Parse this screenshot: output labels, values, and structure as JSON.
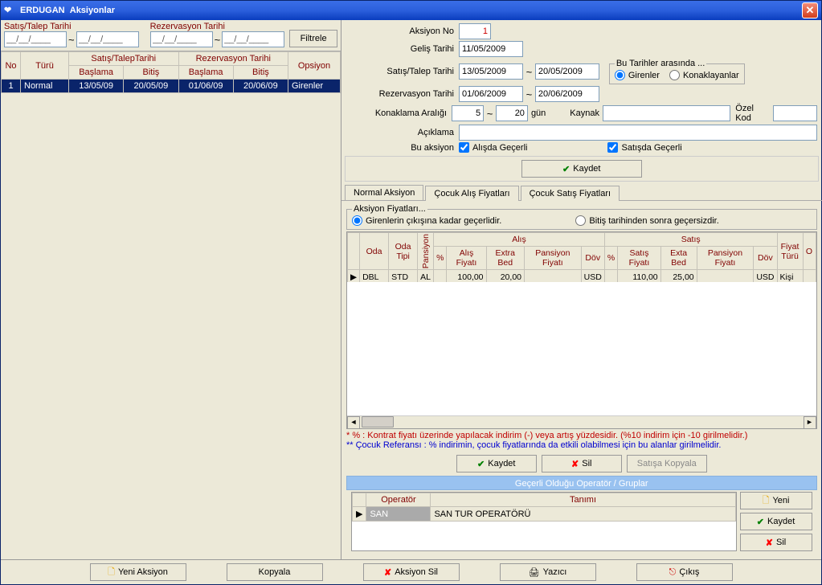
{
  "title_app": "ERDUGAN",
  "title_sub": "Aksiyonlar",
  "filters": {
    "satis_label": "Satış/Talep Tarihi",
    "rezerv_label": "Rezervasyon Tarihi",
    "date_mask": "__/__/____",
    "filtrele": "Filtrele"
  },
  "left_grid": {
    "headers": [
      "No",
      "Türü",
      "Satış/TalepTarihi",
      "Rezervasyon Tarihi",
      "Opsiyon"
    ],
    "sub": [
      "Başlama",
      "Bitiş",
      "Başlama",
      "Bitiş"
    ],
    "row": [
      "1",
      "Normal",
      "13/05/09",
      "20/05/09",
      "01/06/09",
      "20/06/09",
      "Girenler"
    ]
  },
  "form": {
    "aksiyon_no_lbl": "Aksiyon No",
    "aksiyon_no": "1",
    "gelis_lbl": "Geliş Tarihi",
    "gelis": "11/05/2009",
    "satis_lbl": "Satış/Talep Tarihi",
    "satis1": "13/05/2009",
    "satis2": "20/05/2009",
    "rezerv_lbl": "Rezervasyon Tarihi",
    "rez1": "01/06/2009",
    "rez2": "20/06/2009",
    "konak_lbl": "Konaklama Aralığı",
    "k1": "5",
    "k2": "20",
    "gun": "gün",
    "dates_box": "Bu Tarihler arasında ...",
    "girenler": "Girenler",
    "konak": "Konaklayanlar",
    "kaynak_lbl": "Kaynak",
    "ozelkod_lbl": "Özel Kod",
    "aciklama_lbl": "Açıklama",
    "buaksiyon": "Bu aksiyon",
    "alista": "Alışda Geçerli",
    "satista": "Satışda Geçerli",
    "kaydet": "Kaydet"
  },
  "tabs": {
    "normal": "Normal Aksiyon",
    "cocuk_alis": "Çocuk Alış Fiyatları",
    "cocuk_satis": "Çocuk Satış Fiyatları"
  },
  "price_section": {
    "title": "Aksiyon Fiyatları...",
    "r1": "Girenlerin çıkışına kadar geçerlidir.",
    "r2": "Bitiş tarihinden sonra geçersizdir.",
    "h": {
      "oda": "Oda",
      "odatipi": "Oda Tipi",
      "pansiyon": "Pansiyon",
      "alis": "Alış",
      "satis": "Satış",
      "pct": "%",
      "alisfiyat": "Alış Fiyatı",
      "extrabed": "Extra Bed",
      "panfiyat": "Pansiyon Fiyatı",
      "dov": "Döv",
      "satisfiyat": "Satış Fiyatı",
      "extabed": "Exta Bed",
      "fiyatturu": "Fiyat Türü",
      "o": "O"
    },
    "row": {
      "oda": "DBL",
      "odatipi": "STD",
      "pansiyon": "AL",
      "alis_fiyat": "100,00",
      "alis_extra": "20,00",
      "alis_dov": "USD",
      "satis_fiyat": "110,00",
      "satis_exta": "25,00",
      "satis_dov": "USD",
      "fiyatturu": "Kişi"
    }
  },
  "notes": {
    "l1_prefix": "* % : ",
    "l1": "Kontrat fiyatı üzerinde yapılacak indirim (-) veya artış  yüzdesidir. (%10 indirim için -10 girilmelidir.)",
    "l2_prefix": "** Çocuk Referansı : ",
    "l2": "% indirimin, çocuk fiyatlarında da etkili olabilmesi için bu alanlar girilmelidir."
  },
  "buttons": {
    "kaydet": "Kaydet",
    "sil": "Sil",
    "satisa": "Satışa Kopyala"
  },
  "op_section": {
    "header": "Geçerli Olduğu Operatör / Gruplar",
    "h_op": "Operatör",
    "h_tanim": "Tanımı",
    "row_op": "SAN",
    "row_tanim": "SAN TUR OPERATÖRÜ",
    "yeni": "Yeni",
    "kaydet": "Kaydet",
    "sil": "Sil"
  },
  "toolbar": {
    "yeni": "Yeni Aksiyon",
    "kopyala": "Kopyala",
    "sil": "Aksiyon Sil",
    "yazici": "Yazıcı",
    "cikis": "Çıkış"
  }
}
